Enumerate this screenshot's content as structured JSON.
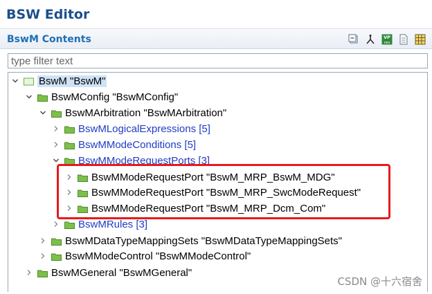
{
  "window": {
    "title": "BSW Editor"
  },
  "section": {
    "title": "BswM Contents"
  },
  "toolbar": {
    "icons": [
      "collapse-all-icon",
      "link-icon",
      "vp-res-icon",
      "document-icon",
      "grid-icon"
    ],
    "vp_top": "VP",
    "vp_bottom": "res"
  },
  "filter": {
    "placeholder": "type filter text",
    "value": ""
  },
  "tree": {
    "root": "BswM \"BswM\"",
    "config": "BswMConfig \"BswMConfig\"",
    "arbitration": "BswMArbitration \"BswMArbitration\"",
    "logical_expressions": "BswMLogicalExpressions [5]",
    "mode_conditions": "BswMModeConditions [5]",
    "mode_request_ports": "BswMModeRequestPorts [3]",
    "ports": [
      "BswMModeRequestPort \"BswM_MRP_BswM_MDG\"",
      "BswMModeRequestPort \"BswM_MRP_SwcModeRequest\"",
      "BswMModeRequestPort \"BswM_MRP_Dcm_Com\""
    ],
    "rules": "BswMRules [3]",
    "data_type_mapping_sets": "BswMDataTypeMappingSets \"BswMDataTypeMappingSets\"",
    "mode_control": "BswMModeControl \"BswMModeControl\"",
    "general": "BswMGeneral \"BswMGeneral\""
  },
  "watermark": "CSDN @十六宿舍",
  "colors": {
    "title": "#1b4f8c",
    "section_title": "#1f6fb5",
    "link": "#1f3cc4",
    "folder": "#7cc04b",
    "highlight": "#e8191c"
  }
}
